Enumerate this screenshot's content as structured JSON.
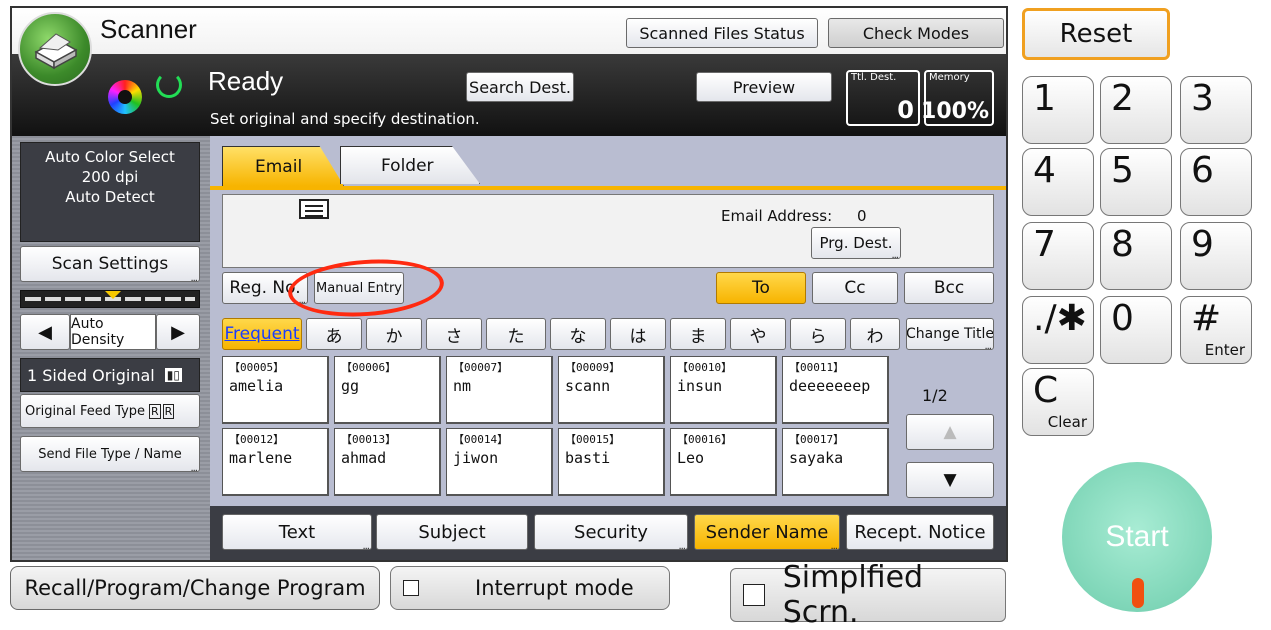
{
  "app": {
    "title": "Scanner"
  },
  "header": {
    "scanned_files_status": "Scanned Files Status",
    "check_modes": "Check Modes"
  },
  "status": {
    "state": "Ready",
    "message": "Set original and specify destination.",
    "search_dest": "Search Dest.",
    "preview": "Preview",
    "ttl_dest_label": "Ttl. Dest.",
    "ttl_dest_value": "0",
    "memory_label": "Memory",
    "memory_value": "100%"
  },
  "left_panel": {
    "settings_lines": [
      "Auto Color Select",
      "200 dpi",
      "Auto Detect"
    ],
    "scan_settings": "Scan Settings",
    "auto_density": "Auto Density",
    "sided_original": "1 Sided Original",
    "original_feed_type": "Original Feed Type",
    "send_file_type": "Send File Type / Name"
  },
  "tabs": [
    {
      "label": "Email",
      "active": true
    },
    {
      "label": "Folder",
      "active": false
    }
  ],
  "destination": {
    "email_address_label": "Email Address:",
    "email_address_count": "0",
    "prg_dest": "Prg. Dest."
  },
  "actions": {
    "reg_no": "Reg. No.",
    "manual_entry": "Manual Entry",
    "to": "To",
    "cc": "Cc",
    "bcc": "Bcc"
  },
  "index_tabs": [
    "Frequent",
    "あ",
    "か",
    "さ",
    "た",
    "な",
    "は",
    "ま",
    "や",
    "ら",
    "わ"
  ],
  "change_title": "Change Title",
  "entries": [
    {
      "no": "【00005】",
      "name": "amelia"
    },
    {
      "no": "【00006】",
      "name": "gg"
    },
    {
      "no": "【00007】",
      "name": "nm"
    },
    {
      "no": "【00009】",
      "name": "scann"
    },
    {
      "no": "【00010】",
      "name": "insun"
    },
    {
      "no": "【00011】",
      "name": "deeeeeeep"
    },
    {
      "no": "【00012】",
      "name": "marlene"
    },
    {
      "no": "【00013】",
      "name": "ahmad"
    },
    {
      "no": "【00014】",
      "name": "jiwon"
    },
    {
      "no": "【00015】",
      "name": "basti"
    },
    {
      "no": "【00016】",
      "name": "Leo"
    },
    {
      "no": "【00017】",
      "name": "sayaka"
    }
  ],
  "pagination": {
    "page": "1/2",
    "up": "▲",
    "down": "▼"
  },
  "bottom_tabs": [
    "Text",
    "Subject",
    "Security",
    "Sender Name",
    "Recept. Notice"
  ],
  "footer": {
    "recall": "Recall/Program/Change Program",
    "interrupt": "Interrupt mode",
    "simplified": "Simplfied Scrn."
  },
  "keypad": {
    "reset": "Reset",
    "keys": [
      "1",
      "2",
      "3",
      "4",
      "5",
      "6",
      "7",
      "8",
      "9",
      "./✱",
      "0",
      "#"
    ],
    "enter": "Enter",
    "clear_main": "C",
    "clear_sub": "Clear",
    "start": "Start"
  },
  "colors": {
    "accent_yellow": "#f7b400",
    "reset_border": "#f0a020",
    "start_green": "#8fe0c4",
    "annotation_red": "#ff2a10"
  }
}
